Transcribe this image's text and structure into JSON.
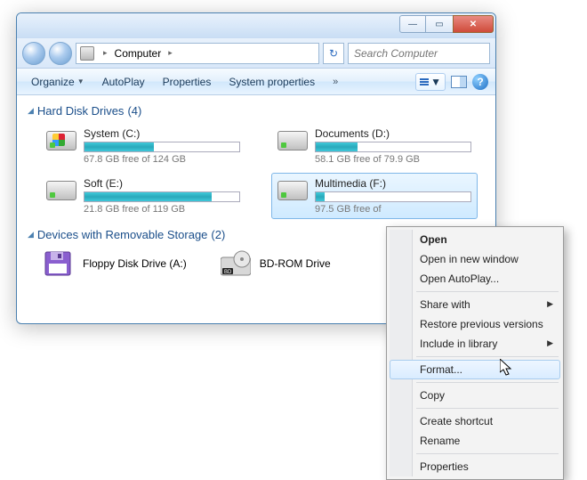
{
  "titlebar": {
    "min": "—",
    "max": "▭",
    "close": "✕"
  },
  "address": {
    "location": "Computer",
    "arrow": "▸"
  },
  "search": {
    "placeholder": "Search Computer"
  },
  "toolbar": {
    "organize": "Organize",
    "autoplay": "AutoPlay",
    "properties": "Properties",
    "system_properties": "System properties",
    "more": "»",
    "help": "?"
  },
  "sections": {
    "hdd": {
      "title": "Hard Disk Drives",
      "count": "(4)"
    },
    "removable": {
      "title": "Devices with Removable Storage",
      "count": "(2)"
    }
  },
  "drives": [
    {
      "name": "System (C:)",
      "free": "67.8 GB free of 124 GB",
      "fill": 45
    },
    {
      "name": "Documents (D:)",
      "free": "58.1 GB free of 79.9 GB",
      "fill": 27
    },
    {
      "name": "Soft (E:)",
      "free": "21.8 GB free of 119 GB",
      "fill": 82
    },
    {
      "name": "Multimedia (F:)",
      "free": "97.5 GB free of",
      "fill": 6
    }
  ],
  "devices": [
    {
      "name": "Floppy Disk Drive (A:)"
    },
    {
      "name": "BD-ROM Drive"
    }
  ],
  "context_menu": {
    "open": "Open",
    "open_new": "Open in new window",
    "open_autoplay": "Open AutoPlay...",
    "share_with": "Share with",
    "restore": "Restore previous versions",
    "include": "Include in library",
    "format": "Format...",
    "copy": "Copy",
    "shortcut": "Create shortcut",
    "rename": "Rename",
    "properties": "Properties"
  }
}
